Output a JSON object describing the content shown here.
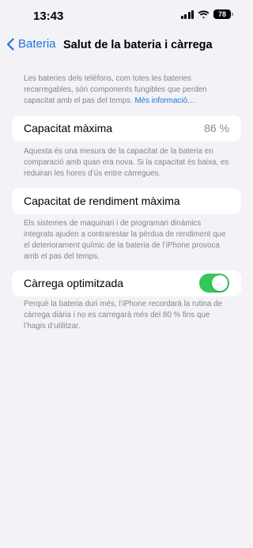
{
  "status_bar": {
    "time": "13:43",
    "battery": "78"
  },
  "nav": {
    "back_label": "Bateria",
    "title": "Salut de la bateria i càrrega"
  },
  "intro": {
    "text": "Les bateries dels telèfons, com totes les bateries recarregables, són components fungibles que perden capacitat amb el pas del temps. ",
    "link": "Més informació…"
  },
  "max_capacity": {
    "label": "Capacitat màxima",
    "value": "86 %",
    "note": "Aquesta és una mesura de la capacitat de la bateria en comparació amb quan era nova. Si la capacitat és baixa, es reduiran les hores d’ús entre càrregues."
  },
  "peak_performance": {
    "label": "Capacitat de rendiment màxima",
    "note": "Els sistemes de maquinari i de programari dinàmics integrats ajuden a contrarestar la pèrdua de rendiment que el deteriorament químic de la bateria de l’iPhone provoca amb el pas del temps."
  },
  "optimized_charging": {
    "label": "Càrrega optimitzada",
    "enabled": true,
    "note": "Perquè la bateria duri més, l’iPhone recordarà la rutina de càrrega diària i no es carregarà més del 80 % fins que l’hagis d’utilitzar."
  },
  "colors": {
    "accent": "#1e74d6",
    "toggle_on": "#34c759",
    "background": "#f2f2f7",
    "footnote": "#85858b"
  }
}
